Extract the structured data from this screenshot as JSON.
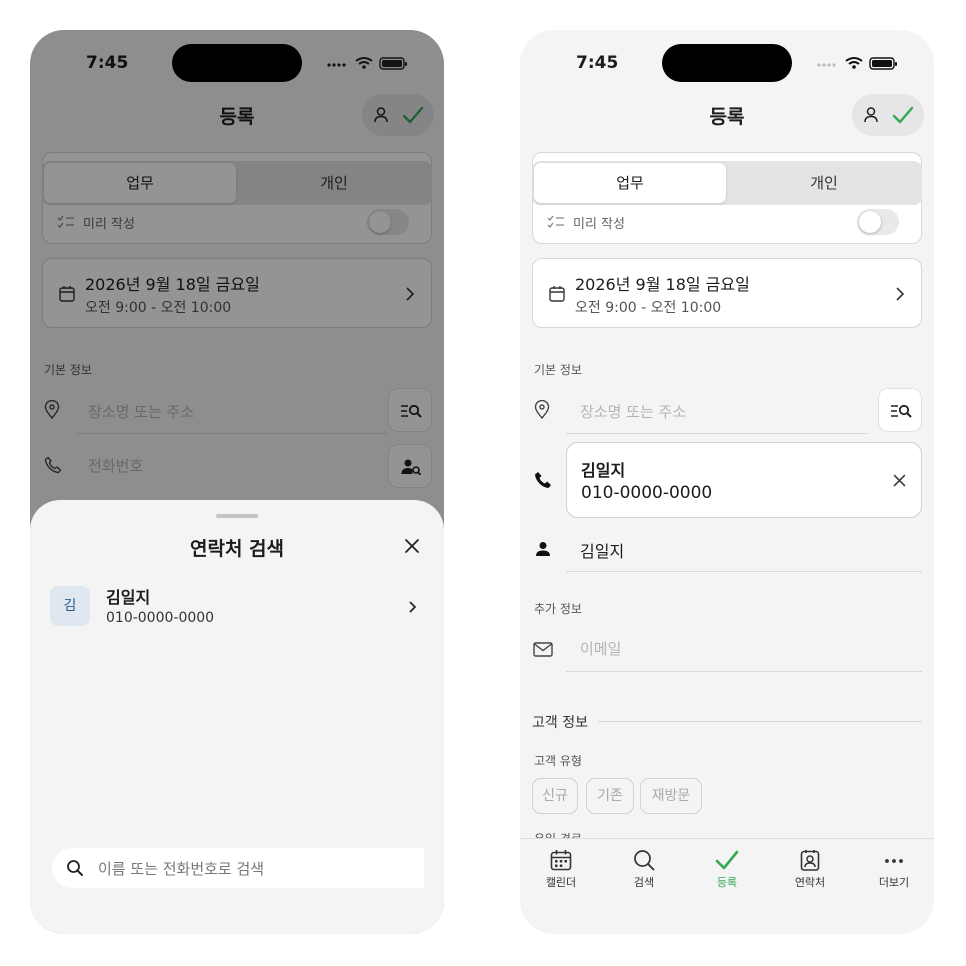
{
  "status": {
    "time": "7:45"
  },
  "header": {
    "title": "등록"
  },
  "segment": {
    "work": "업무",
    "personal": "개인"
  },
  "prefill": {
    "label": "미리 작성",
    "enabled": false
  },
  "schedule": {
    "date": "2026년 9월 18일 금요일",
    "time_range": "오전 9:00 - 오전 10:00"
  },
  "basic_info": {
    "label": "기본 정보",
    "place_placeholder": "장소명 또는 주소",
    "phone_placeholder": "전화번호"
  },
  "selected_contact": {
    "name": "김일지",
    "phone": "010-0000-0000"
  },
  "name_field": {
    "value": "김일지"
  },
  "extra_info": {
    "label": "추가 정보",
    "email_placeholder": "이메일"
  },
  "customer_info": {
    "label": "고객 정보",
    "type_label": "고객 유형",
    "types": [
      "신규",
      "기존",
      "재방문"
    ],
    "partial_next_label": "유입 경로"
  },
  "contact_sheet": {
    "title": "연락처 검색",
    "results": [
      {
        "initial": "김",
        "name": "김일지",
        "phone": "010-0000-0000"
      }
    ],
    "search_placeholder": "이름 또는 전화번호로 검색"
  },
  "tabbar": {
    "active": "register",
    "accent": "#34a853",
    "items": [
      {
        "id": "calendar",
        "label": "캘린더",
        "icon": "calendar-icon"
      },
      {
        "id": "search",
        "label": "검색",
        "icon": "search-icon"
      },
      {
        "id": "register",
        "label": "등록",
        "icon": "checkmark-icon"
      },
      {
        "id": "contacts",
        "label": "연락처",
        "icon": "contact-card-icon"
      },
      {
        "id": "more",
        "label": "더보기",
        "icon": "more-icon"
      }
    ]
  },
  "colors": {
    "accent_green": "#34a853",
    "overlay": "rgba(0,0,0,0.42)"
  }
}
